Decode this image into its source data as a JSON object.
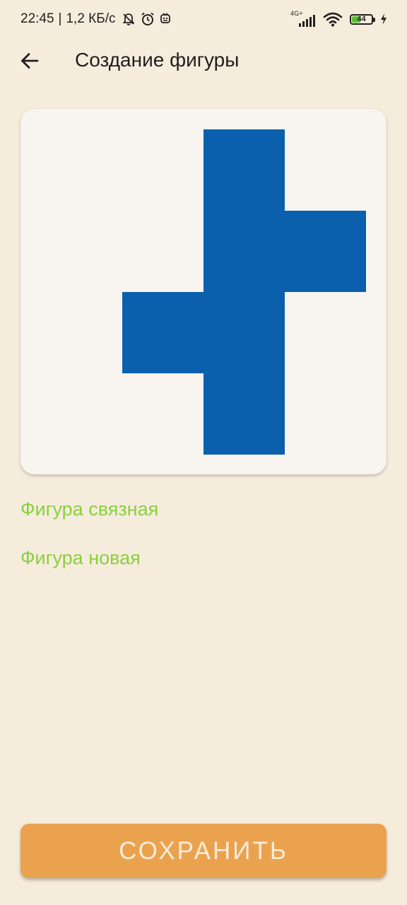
{
  "status_bar": {
    "time": "22:45",
    "separator": "|",
    "speed": "1,2 КБ/с",
    "net_type": "4G+",
    "battery": "44",
    "battery_level": 0.44,
    "icons": [
      "bell-off-icon",
      "alarm-icon",
      "notification-icon",
      "signal-icon",
      "wifi-icon",
      "battery-icon",
      "charging-icon"
    ]
  },
  "header": {
    "back_icon": "arrow-left-icon",
    "title": "Создание фигуры"
  },
  "shape": {
    "grid_size": 4,
    "fill_color": "#0a60ad",
    "background_color": "#f8f4ef",
    "cells": [
      {
        "row": 0,
        "col": 2
      },
      {
        "row": 1,
        "col": 2
      },
      {
        "row": 1,
        "col": 3
      },
      {
        "row": 2,
        "col": 1
      },
      {
        "row": 2,
        "col": 2
      },
      {
        "row": 3,
        "col": 2
      }
    ]
  },
  "status": {
    "connected": "Фигура связная",
    "new": "Фигура новая",
    "color": "#8bcf3e"
  },
  "actions": {
    "save_label": "СОХРАНИТЬ",
    "save_color": "#eba24f",
    "save_text_color": "#f8ecd8"
  },
  "colors": {
    "background": "#f5ecdc",
    "text": "#1f1f1f"
  }
}
